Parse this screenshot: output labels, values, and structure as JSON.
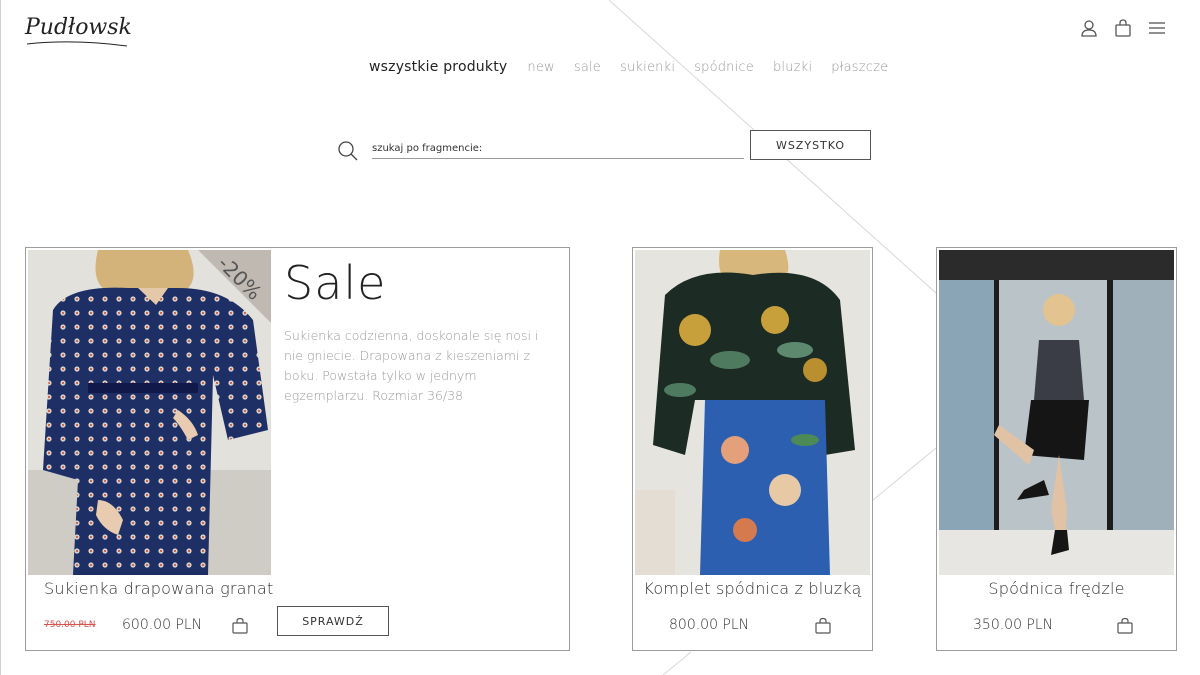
{
  "brand": {
    "logo_text": "Pudłowska"
  },
  "header": {
    "icons": [
      "user-icon",
      "bag-icon",
      "menu-icon"
    ]
  },
  "nav": {
    "items": [
      {
        "label": "wszystkie produkty",
        "active": true
      },
      {
        "label": "new"
      },
      {
        "label": "sale"
      },
      {
        "label": "sukienki"
      },
      {
        "label": "spódnice"
      },
      {
        "label": "bluzki"
      },
      {
        "label": "płaszcze"
      }
    ]
  },
  "search": {
    "placeholder": "szukaj po fragmencie:",
    "button_label": "WSZYSTKO"
  },
  "featured": {
    "heading": "Sale",
    "discount_badge": "-20%",
    "description": "Sukienka codzienna, doskonale się nosi i nie gniecie. Drapowana z kieszeniami z boku. Powstała tylko w jednym egzemplarzu. Rozmiar 36/38",
    "title": "Sukienka drapowana granat",
    "old_price": "750.00 PLN",
    "price": "600.00 PLN",
    "button_label": "SPRAWDŹ"
  },
  "products": [
    {
      "title": "Komplet spódnica z bluzką",
      "price": "800.00 PLN"
    },
    {
      "title": "Spódnica frędzle",
      "price": "350.00 PLN"
    }
  ],
  "colors": {
    "text": "#222222",
    "muted": "#9a9a9a",
    "sale_red": "#d9534f",
    "border": "#9c9c9c"
  }
}
